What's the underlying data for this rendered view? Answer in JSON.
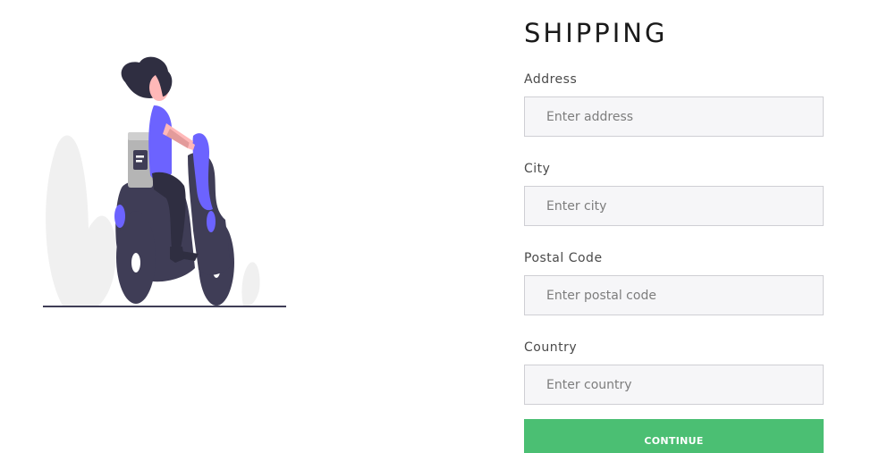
{
  "illustration": {
    "name": "delivery-scooter-illustration",
    "colors": {
      "accent": "#6c63ff",
      "dark": "#3f3d56",
      "hair": "#2f2e41",
      "skin": "#ffb8b8",
      "plant": "#f0f0f0",
      "box": "#b5b5b5"
    }
  },
  "form": {
    "title": "SHIPPING",
    "fields": [
      {
        "label": "Address",
        "placeholder": "Enter address",
        "value": ""
      },
      {
        "label": "City",
        "placeholder": "Enter city",
        "value": ""
      },
      {
        "label": "Postal Code",
        "placeholder": "Enter postal code",
        "value": ""
      },
      {
        "label": "Country",
        "placeholder": "Enter country",
        "value": ""
      }
    ],
    "submit_label": "CONTINUE",
    "submit_color": "#4bbf73"
  }
}
